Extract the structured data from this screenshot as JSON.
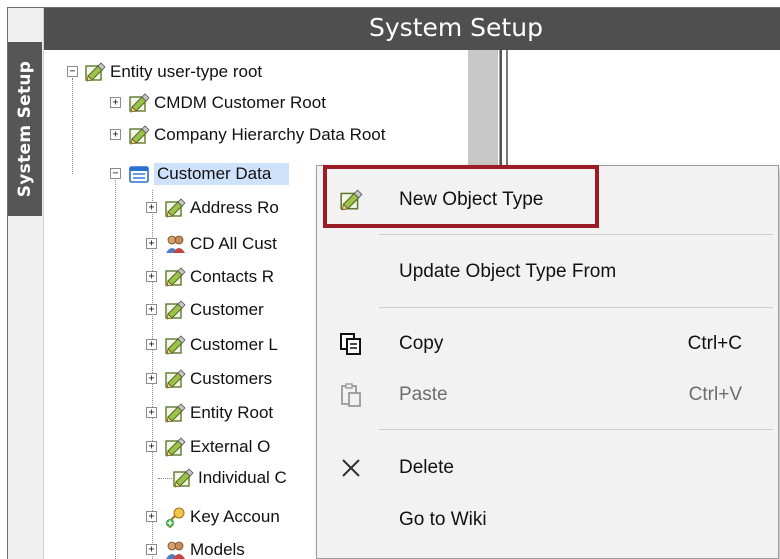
{
  "header": {
    "title": "System Setup"
  },
  "side_tab": {
    "label": "System Setup"
  },
  "tree": {
    "root": {
      "label": "Entity user-type root",
      "expander": "−"
    },
    "level1": [
      {
        "label": "CMDM Customer Root",
        "expander": "+",
        "icon": "object-type-icon"
      },
      {
        "label": "Company Hierarchy Data Root",
        "expander": "+",
        "icon": "object-type-icon"
      },
      {
        "label": "Customer Data",
        "expander": "−",
        "icon": "folder-icon",
        "selected": true
      }
    ],
    "children": [
      {
        "label": "Address Ro",
        "expander": "+",
        "icon": "object-type-icon"
      },
      {
        "label": "CD All Cust",
        "expander": "+",
        "icon": "users-icon"
      },
      {
        "label": "Contacts R",
        "expander": "+",
        "icon": "object-type-icon"
      },
      {
        "label": "Customer",
        "expander": "+",
        "icon": "object-type-icon"
      },
      {
        "label": "Customer L",
        "expander": "+",
        "icon": "object-type-icon"
      },
      {
        "label": "Customers",
        "expander": "+",
        "icon": "object-type-icon"
      },
      {
        "label": "Entity Root",
        "expander": "+",
        "icon": "object-type-icon"
      },
      {
        "label": "External O",
        "expander": "+",
        "icon": "object-type-icon"
      },
      {
        "label": "Individual C",
        "expander": "",
        "icon": "object-type-icon"
      },
      {
        "label": "Key Accoun",
        "expander": "+",
        "icon": "key-icon"
      },
      {
        "label": "Models",
        "expander": "+",
        "icon": "users-icon"
      }
    ]
  },
  "context_menu": {
    "items": [
      {
        "label": "New Object Type",
        "shortcut": "",
        "icon": "object-type-icon",
        "enabled": true
      },
      {
        "label": "Update Object Type From",
        "shortcut": "",
        "icon": "",
        "enabled": true
      },
      {
        "label": "Copy",
        "shortcut": "Ctrl+C",
        "icon": "copy-icon",
        "enabled": true
      },
      {
        "label": "Paste",
        "shortcut": "Ctrl+V",
        "icon": "paste-icon",
        "enabled": false
      },
      {
        "label": "Delete",
        "shortcut": "",
        "icon": "close-icon",
        "enabled": true
      },
      {
        "label": "Go to Wiki",
        "shortcut": "",
        "icon": "",
        "enabled": true
      }
    ]
  },
  "colors": {
    "header_bg": "#4f4f4f",
    "highlight_border": "#9b1c25",
    "selection_bg": "#cfe2fb",
    "menu_bg": "#f2f2f2"
  }
}
